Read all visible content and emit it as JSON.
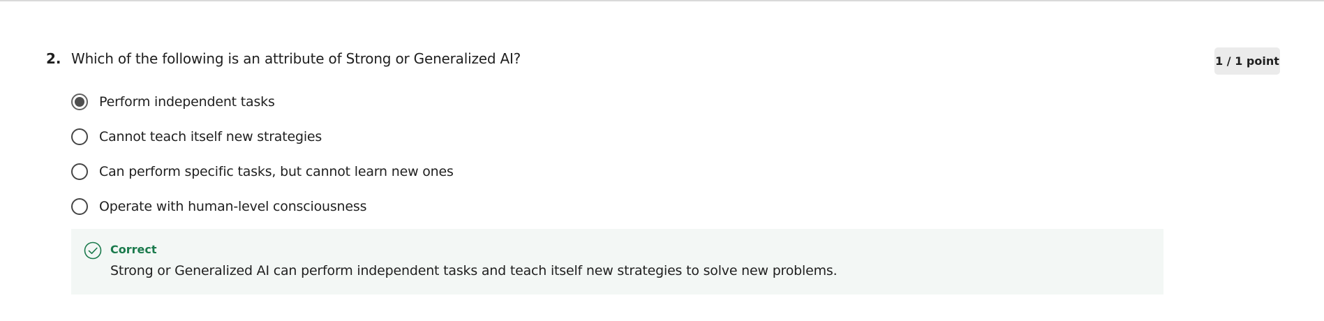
{
  "question": {
    "number": "2.",
    "text": "Which of the following is an attribute of Strong or Generalized AI?",
    "points": "1 / 1 point"
  },
  "options": [
    {
      "label": "Perform independent tasks",
      "selected": true
    },
    {
      "label": "Cannot teach itself new strategies",
      "selected": false
    },
    {
      "label": "Can perform specific tasks, but cannot learn new ones",
      "selected": false
    },
    {
      "label": "Operate with human-level consciousness",
      "selected": false
    }
  ],
  "feedback": {
    "icon": "check-circle-icon",
    "status": "Correct",
    "explanation": "Strong or Generalized AI can perform independent tasks and teach itself new strategies to solve new problems.",
    "accent_color": "#1a7a4c",
    "background_color": "#f3f7f5"
  }
}
